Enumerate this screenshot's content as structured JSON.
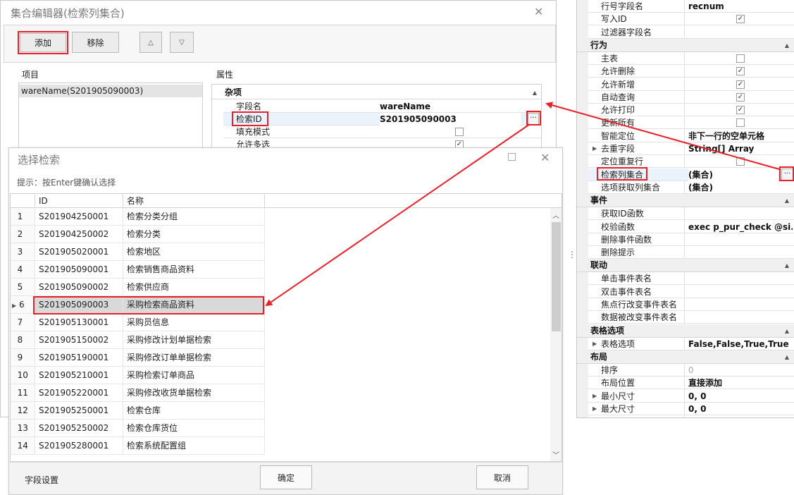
{
  "collection_editor": {
    "title": "集合编辑器(检索列集合)",
    "add_label": "添加",
    "remove_label": "移除",
    "up_icon": "up-triangle-icon",
    "down_icon": "down-triangle-icon",
    "items_label": "项目",
    "items": [
      "wareName(S201905090003)"
    ],
    "props_label": "属性",
    "props_category": "杂项",
    "props": [
      {
        "name": "字段名",
        "value": "wareName"
      },
      {
        "name": "检索ID",
        "value": "S201905090003"
      },
      {
        "name": "填充模式",
        "value": "",
        "check": false
      },
      {
        "name": "允许多选",
        "value": "",
        "check": true
      }
    ]
  },
  "select_dialog": {
    "title": "选择检索",
    "hint": "提示：按Enter键确认选择",
    "col_id": "ID",
    "col_name": "名称",
    "rows": [
      {
        "n": "1",
        "id": "S201904250001",
        "name": "检索分类分组"
      },
      {
        "n": "2",
        "id": "S201904250002",
        "name": "检索分类"
      },
      {
        "n": "3",
        "id": "S201905020001",
        "name": "检索地区"
      },
      {
        "n": "4",
        "id": "S201905090001",
        "name": "检索销售商品资料"
      },
      {
        "n": "5",
        "id": "S201905090002",
        "name": "检索供应商"
      },
      {
        "n": "6",
        "id": "S201905090003",
        "name": "采购检索商品资料"
      },
      {
        "n": "7",
        "id": "S201905130001",
        "name": "采购员信息"
      },
      {
        "n": "8",
        "id": "S201905150002",
        "name": "采购修改计划单据检索"
      },
      {
        "n": "9",
        "id": "S201905190001",
        "name": "采购修改订单单据检索"
      },
      {
        "n": "10",
        "id": "S201905210001",
        "name": "采购检索订单商品"
      },
      {
        "n": "11",
        "id": "S201905220001",
        "name": "采购修改收货单据检索"
      },
      {
        "n": "12",
        "id": "S201905250001",
        "name": "检索仓库"
      },
      {
        "n": "13",
        "id": "S201905250002",
        "name": "检索仓库货位"
      },
      {
        "n": "14",
        "id": "S201905280001",
        "name": "检索系统配置组"
      }
    ],
    "selected_index": 5,
    "field_settings_label": "字段设置",
    "ok_label": "确定",
    "cancel_label": "取消"
  },
  "property_grid": {
    "rows": [
      {
        "type": "prop",
        "name": "行号字段名",
        "value": "recnum"
      },
      {
        "type": "prop",
        "name": "写入ID",
        "check": true
      },
      {
        "type": "prop",
        "name": "过滤器字段名",
        "value": ""
      },
      {
        "type": "cat",
        "name": "行为"
      },
      {
        "type": "prop",
        "name": "主表",
        "check": false
      },
      {
        "type": "prop",
        "name": "允许删除",
        "check": true
      },
      {
        "type": "prop",
        "name": "允许新增",
        "check": true
      },
      {
        "type": "prop",
        "name": "自动查询",
        "check": true
      },
      {
        "type": "prop",
        "name": "允许打印",
        "check": true
      },
      {
        "type": "prop",
        "name": "更新所有",
        "check": false
      },
      {
        "type": "prop",
        "name": "智能定位",
        "value": "非下一行的空单元格"
      },
      {
        "type": "prop",
        "name": "去重字段",
        "value": "String[] Array",
        "expand": true
      },
      {
        "type": "prop",
        "name": "定位重复行",
        "check": false
      },
      {
        "type": "prop",
        "name": "检索列集合",
        "value": "(集合)",
        "ellipsis": true,
        "highlight": true
      },
      {
        "type": "prop",
        "name": "选项获取列集合",
        "value": "(集合)"
      },
      {
        "type": "cat",
        "name": "事件"
      },
      {
        "type": "prop",
        "name": "获取ID函数",
        "value": ""
      },
      {
        "type": "prop",
        "name": "校验函数",
        "value": "exec p_pur_check @si..."
      },
      {
        "type": "prop",
        "name": "删除事件函数",
        "value": ""
      },
      {
        "type": "prop",
        "name": "删除提示",
        "value": ""
      },
      {
        "type": "cat",
        "name": "联动"
      },
      {
        "type": "prop",
        "name": "单击事件表名",
        "value": ""
      },
      {
        "type": "prop",
        "name": "双击事件表名",
        "value": ""
      },
      {
        "type": "prop",
        "name": "焦点行改变事件表名",
        "value": ""
      },
      {
        "type": "prop",
        "name": "数据被改变事件表名",
        "value": ""
      },
      {
        "type": "cat",
        "name": "表格选项"
      },
      {
        "type": "prop",
        "name": "表格选项",
        "value": "False,False,True,True",
        "expand": true
      },
      {
        "type": "cat",
        "name": "布局"
      },
      {
        "type": "prop",
        "name": "排序",
        "value": "0",
        "disabled": true
      },
      {
        "type": "prop",
        "name": "布局位置",
        "value": "直接添加"
      },
      {
        "type": "prop",
        "name": "最小尺寸",
        "value": "0, 0",
        "expand": true
      },
      {
        "type": "prop",
        "name": "最大尺寸",
        "value": "0, 0",
        "expand": true
      }
    ]
  },
  "colors": {
    "annotation": "#e8202a",
    "selected_row": "#d9d9d9",
    "category_bg": "#f0f0f0"
  }
}
